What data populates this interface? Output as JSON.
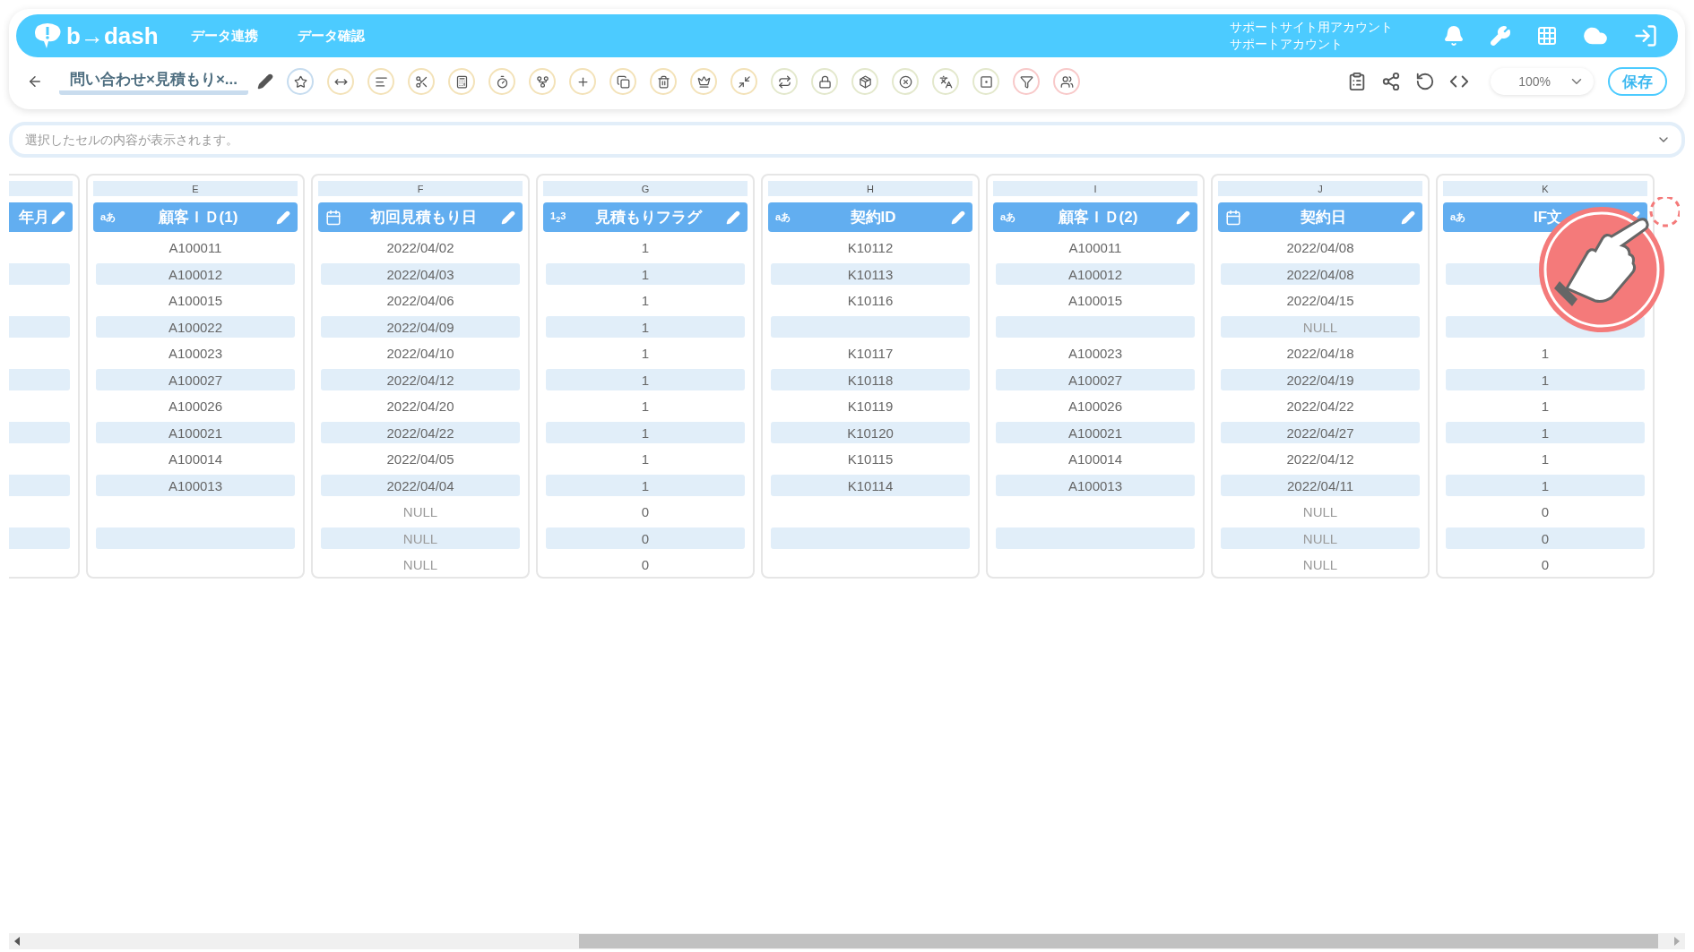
{
  "header": {
    "logo": "b→dash",
    "nav": [
      {
        "label": "データ連携"
      },
      {
        "label": "データ確認"
      }
    ],
    "account": [
      "サポートサイト用アカウント",
      "サポートアカウント"
    ]
  },
  "toolbar": {
    "title": "問い合わせ×見積もり×...",
    "tools": [
      {
        "color": "#c6dcef"
      },
      {
        "color": "#f3e2b8"
      },
      {
        "color": "#f3e2b8"
      },
      {
        "color": "#f3e2b8"
      },
      {
        "color": "#f3e2b8"
      },
      {
        "color": "#f3e2b8"
      },
      {
        "color": "#f3e2b8"
      },
      {
        "color": "#f3e2b8"
      },
      {
        "color": "#f3e2b8"
      },
      {
        "color": "#f3e2b8"
      },
      {
        "color": "#f3e2b8"
      },
      {
        "color": "#f3e2b8"
      },
      {
        "color": "#e3e8cc"
      },
      {
        "color": "#e3e8cc"
      },
      {
        "color": "#e3e8cc"
      },
      {
        "color": "#e3e8cc"
      },
      {
        "color": "#e3e8cc"
      },
      {
        "color": "#e3e8cc"
      },
      {
        "color": "#f8c9c9"
      },
      {
        "color": "#f8c9c9"
      }
    ],
    "zoom": "100%",
    "save": "保存"
  },
  "formula_bar": {
    "placeholder": "選択したセルの内容が表示されます。"
  },
  "table": {
    "columns": [
      {
        "name": "年月",
        "cells": [
          null,
          null,
          null,
          null,
          null,
          null,
          null,
          null,
          null,
          null,
          null,
          null,
          null
        ]
      },
      {
        "letter": "E",
        "name": "顧客ＩＤ(1)",
        "kind": "text",
        "badge": "aあ",
        "cells": [
          "A100011",
          "A100012",
          "A100015",
          "A100022",
          "A100023",
          "A100027",
          "A100026",
          "A100021",
          "A100014",
          "A100013",
          null,
          null,
          null
        ]
      },
      {
        "letter": "F",
        "name": "初回見積もり日",
        "kind": "date",
        "cells": [
          "2022/04/02",
          "2022/04/03",
          "2022/04/06",
          "2022/04/09",
          "2022/04/10",
          "2022/04/12",
          "2022/04/20",
          "2022/04/22",
          "2022/04/05",
          "2022/04/04",
          {
            "text": "NULL",
            "null": true
          },
          {
            "text": "NULL",
            "null": true
          },
          {
            "text": "NULL",
            "null": true
          }
        ]
      },
      {
        "letter": "G",
        "name": "見積もりフラグ",
        "kind": "number",
        "badge": "1$_{2}$3",
        "cells": [
          "1",
          "1",
          "1",
          "1",
          "1",
          "1",
          "1",
          "1",
          "1",
          "1",
          "0",
          "0",
          "0"
        ]
      },
      {
        "letter": "H",
        "name": "契約ID",
        "kind": "text",
        "badge": "aあ",
        "cells": [
          "K10112",
          "K10113",
          "K10116",
          null,
          "K10117",
          "K10118",
          "K10119",
          "K10120",
          "K10115",
          "K10114",
          null,
          null,
          null
        ]
      },
      {
        "letter": "I",
        "name": "顧客ＩＤ(2)",
        "kind": "text",
        "badge": "aあ",
        "cells": [
          "A100011",
          "A100012",
          "A100015",
          null,
          "A100023",
          "A100027",
          "A100026",
          "A100021",
          "A100014",
          "A100013",
          null,
          null,
          null
        ]
      },
      {
        "letter": "J",
        "name": "契約日",
        "kind": "date",
        "cells": [
          "2022/04/08",
          "2022/04/08",
          "2022/04/15",
          {
            "text": "NULL",
            "null": true
          },
          "2022/04/18",
          "2022/04/19",
          "2022/04/22",
          "2022/04/27",
          "2022/04/12",
          "2022/04/11",
          {
            "text": "NULL",
            "null": true
          },
          {
            "text": "NULL",
            "null": true
          },
          {
            "text": "NULL",
            "null": true
          }
        ]
      },
      {
        "letter": "K",
        "name": "IF文",
        "kind": "text",
        "badge": "aあ",
        "cells": [
          null,
          null,
          null,
          null,
          "1",
          "1",
          "1",
          "1",
          "1",
          "1",
          "0",
          "0",
          "0"
        ]
      }
    ]
  }
}
